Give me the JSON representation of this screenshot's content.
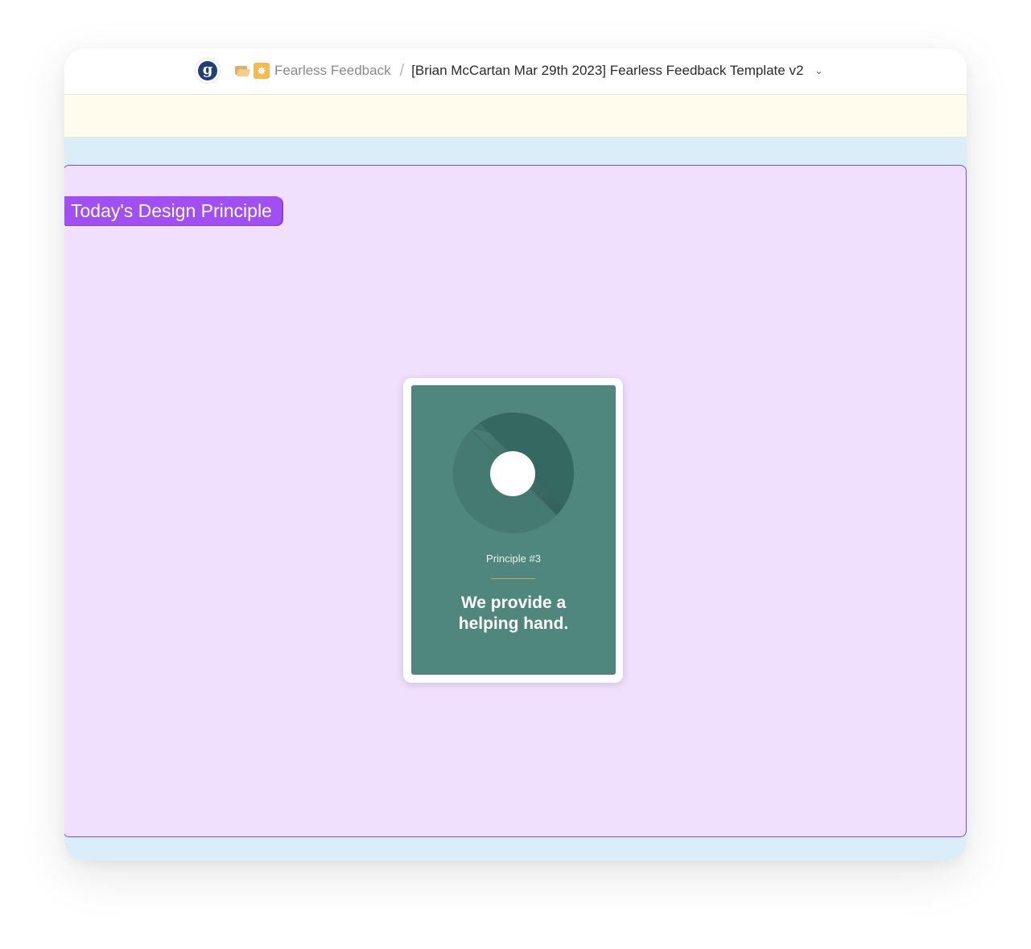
{
  "app": {
    "logo_letter": "g"
  },
  "breadcrumb": {
    "folder_icon": "folder-open-icon",
    "spark_icon": "sparkle-icon",
    "spark_glyph": "✸",
    "parent": "Fearless Feedback",
    "separator": "/",
    "current": "[Brian McCartan Mar 29th 2023] Fearless Feedback Template v2",
    "chevron": "⌄"
  },
  "frame": {
    "label": "Today's Design Principle"
  },
  "card": {
    "kicker": "Principle #3",
    "title_line1": "We provide a",
    "title_line2": "helping hand."
  },
  "colors": {
    "canvas": "#daeefa",
    "frame_fill": "#f0e0fd",
    "frame_border": "#7d4ee6",
    "label_bg": "#9f4ff2",
    "card_bg": "#4f877e",
    "notice_bg": "#fffcee"
  }
}
